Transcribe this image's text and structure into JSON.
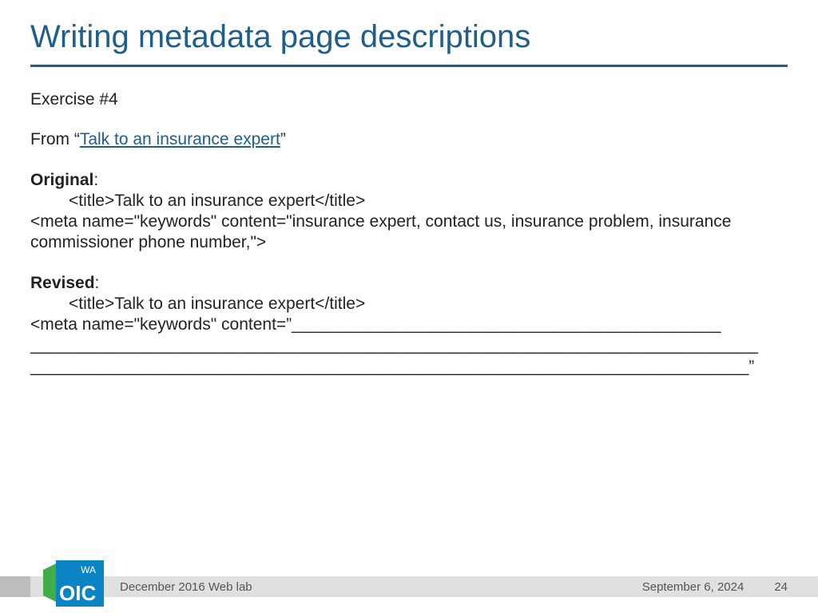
{
  "title": "Writing metadata page descriptions",
  "exercise": "Exercise #4",
  "from_prefix": "From “",
  "from_link": "Talk to an insurance expert",
  "from_suffix": "”",
  "original_label": "Original",
  "original_title_line": "<title>Talk to an insurance expert</title>",
  "original_meta_line": "<meta name=\"keywords\" content=\"insurance expert, contact us, insurance problem, insurance commissioner phone number,\">",
  "revised_label": "Revised",
  "revised_title_line": "<title>Talk to an insurance expert</title>",
  "revised_meta_prefix": "<meta name=\"keywords\" content=”",
  "revised_blank_1": "______________________________________________",
  "revised_blank_2": "______________________________________________________________________________",
  "revised_blank_3": "_____________________________________________________________________________”",
  "footer_left": "December 2016 Web lab",
  "footer_date": "September 6, 2024",
  "footer_page": "24",
  "logo_wa": "WA",
  "logo_oic": "OIC"
}
